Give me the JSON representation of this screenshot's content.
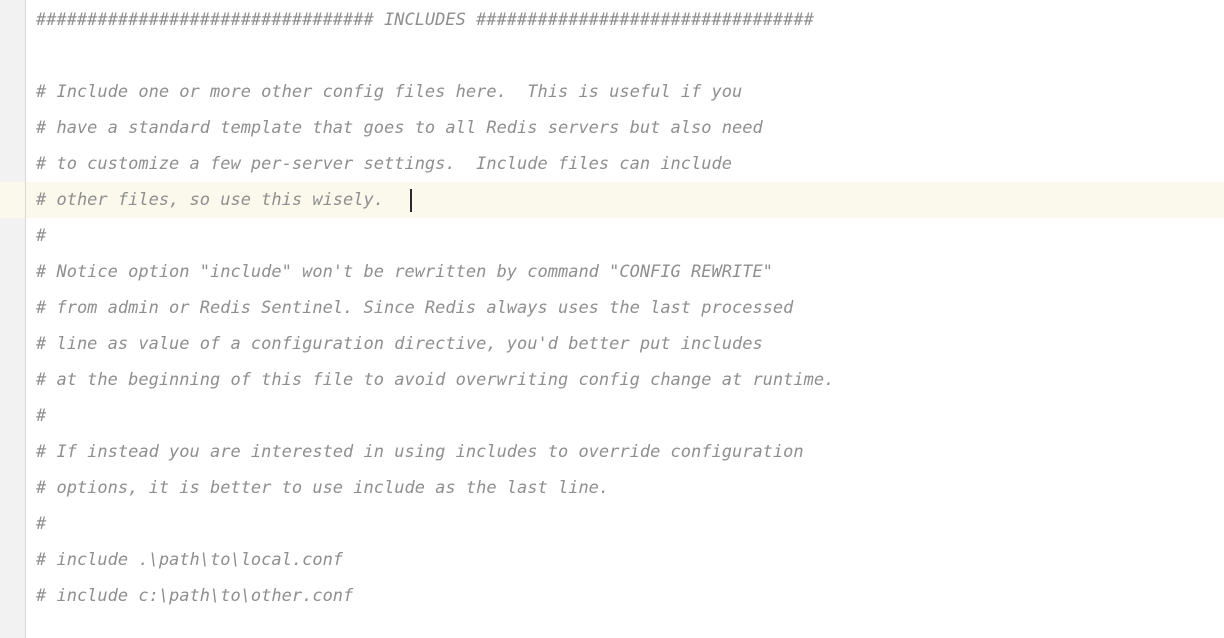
{
  "editor": {
    "gutter_color": "#f2f2f2",
    "gutter_border_color": "#d8d8d8",
    "background_color": "#ffffff",
    "comment_color": "#8f8f8f",
    "highlight_line_color": "#fbf9ec",
    "caret_color": "#2b2b2b",
    "caret_line_index": 5,
    "caret_column": 34,
    "lines": [
      {
        "text": "################################# INCLUDES #################################",
        "highlighted": false
      },
      {
        "text": "",
        "highlighted": false
      },
      {
        "text": "# Include one or more other config files here.  This is useful if you",
        "highlighted": false
      },
      {
        "text": "# have a standard template that goes to all Redis servers but also need",
        "highlighted": false
      },
      {
        "text": "# to customize a few per-server settings.  Include files can include",
        "highlighted": false
      },
      {
        "text": "# other files, so use this wisely.",
        "highlighted": true
      },
      {
        "text": "#",
        "highlighted": false
      },
      {
        "text": "# Notice option \"include\" won't be rewritten by command \"CONFIG REWRITE\"",
        "highlighted": false
      },
      {
        "text": "# from admin or Redis Sentinel. Since Redis always uses the last processed",
        "highlighted": false
      },
      {
        "text": "# line as value of a configuration directive, you'd better put includes",
        "highlighted": false
      },
      {
        "text": "# at the beginning of this file to avoid overwriting config change at runtime.",
        "highlighted": false
      },
      {
        "text": "#",
        "highlighted": false
      },
      {
        "text": "# If instead you are interested in using includes to override configuration",
        "highlighted": false
      },
      {
        "text": "# options, it is better to use include as the last line.",
        "highlighted": false
      },
      {
        "text": "#",
        "highlighted": false
      },
      {
        "text": "# include .\\path\\to\\local.conf",
        "highlighted": false
      },
      {
        "text": "# include c:\\path\\to\\other.conf",
        "highlighted": false
      }
    ]
  }
}
